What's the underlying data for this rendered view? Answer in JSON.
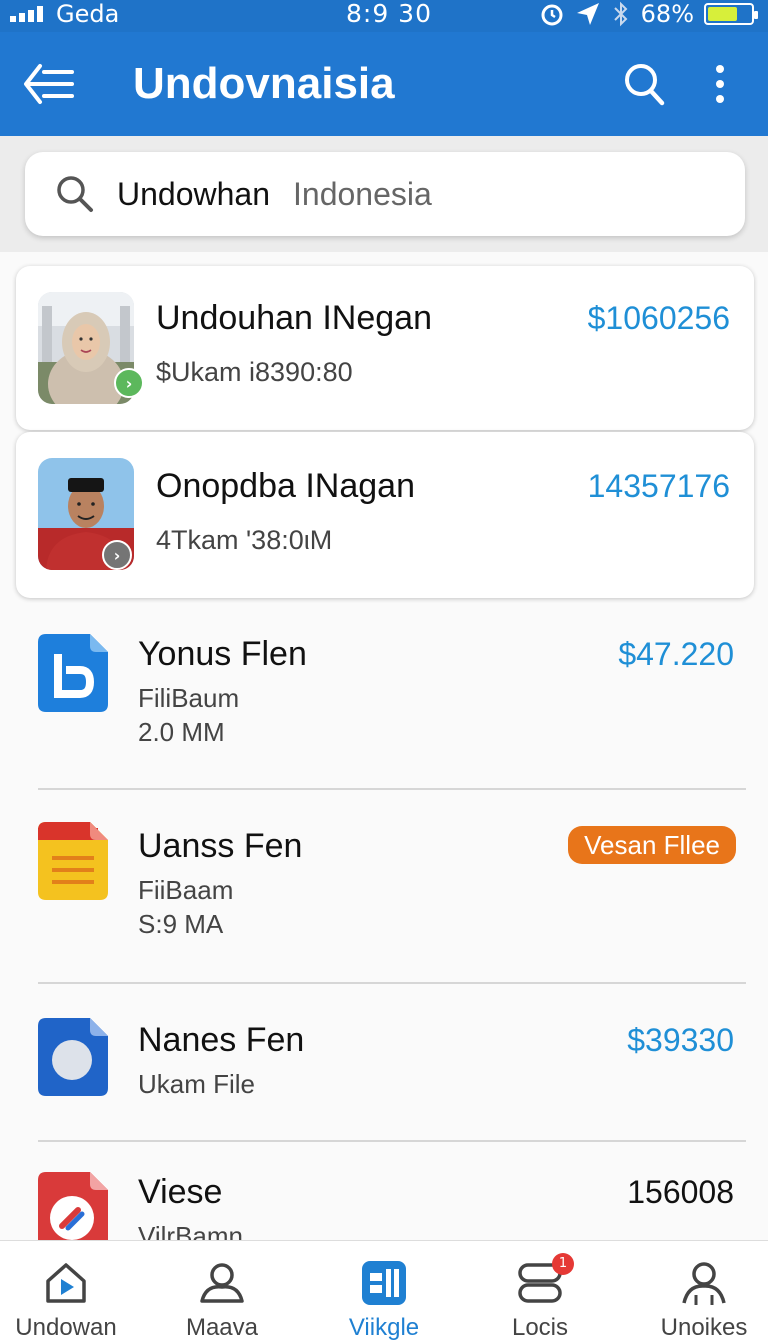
{
  "status_bar": {
    "carrier": "Geda",
    "time": "8:9 30",
    "battery_percent": "68%",
    "battery_level": 0.68,
    "icons": [
      "signal-icon",
      "alarm-icon",
      "location-icon",
      "bluetooth-icon",
      "battery-icon"
    ]
  },
  "app_bar": {
    "title": "Undovnaisia",
    "back_icon": "back-menu-icon",
    "search_icon": "search-icon",
    "more_icon": "more-vertical-icon"
  },
  "search": {
    "query": "Undowhan",
    "hint": "Indonesia"
  },
  "cards": [
    {
      "name": "Undouhan INegan",
      "sub": "$Ukam i8390:80",
      "amount": "$1060256",
      "badge_color": "#5cb85c"
    },
    {
      "name": "Onopdba INagan",
      "sub": "4Tkam '38:0ιM",
      "amount": "14357176",
      "badge_color": "#757575"
    }
  ],
  "files": [
    {
      "name": "Yonus Flen",
      "line1": "FiliBaum",
      "line2": "2.0 MM",
      "amount": "$47.220",
      "icon": "blue-doc-icon"
    },
    {
      "name": "Uanss Fen",
      "line1": "FiiBaam",
      "line2": "S:9 MA",
      "pill": "Vesan Fllee",
      "icon": "yellow-notes-icon"
    },
    {
      "name": "Nanes Fen",
      "line1": "Ukam File",
      "amount": "$39330",
      "icon": "blue-circle-doc-icon"
    },
    {
      "name": "Viese",
      "line1": "VilrBamn",
      "amount": "156008",
      "icon": "red-app-icon"
    }
  ],
  "bottom_nav": [
    {
      "label": "Undowan",
      "icon": "home-play-icon"
    },
    {
      "label": "Maava",
      "icon": "person-icon"
    },
    {
      "label": "Viikgle",
      "icon": "grid-app-icon",
      "active": true
    },
    {
      "label": "Locis",
      "icon": "chat-stack-icon",
      "badge": "1"
    },
    {
      "label": "Unoikes",
      "icon": "people-icon"
    }
  ],
  "colors": {
    "primary": "#2178d1",
    "status_bar": "#1f73c8",
    "amount_blue": "#1f8fd6",
    "pill_orange": "#e8751a",
    "badge_red": "#e53935"
  }
}
